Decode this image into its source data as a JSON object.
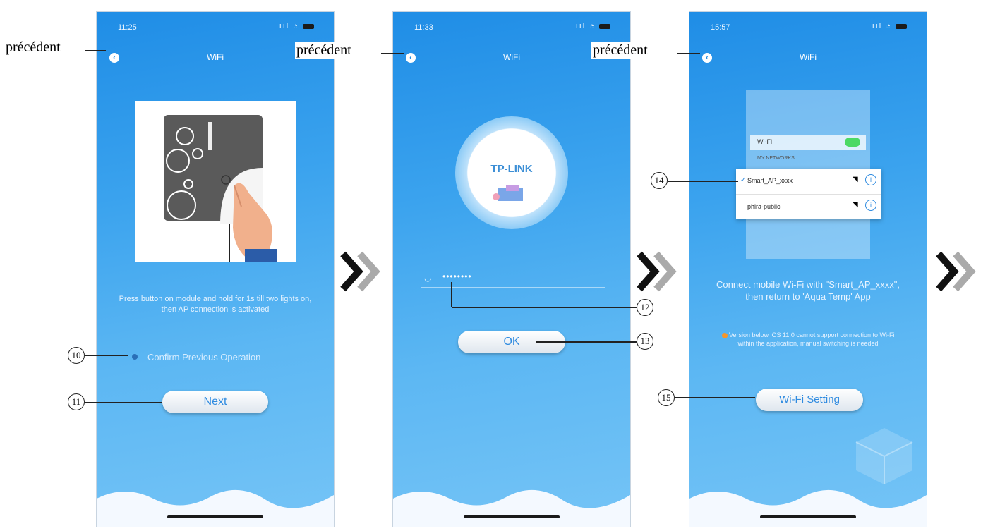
{
  "annotations": {
    "previous_label": "précédent",
    "callouts": [
      "10",
      "11",
      "12",
      "13",
      "14",
      "15"
    ]
  },
  "screens": [
    {
      "time": "11:25",
      "title": "WiFi",
      "description": "Press button on module and hold for 1s till two lights on, then AP connection is activated",
      "confirm_label": "Confirm Previous Operation",
      "next_label": "Next"
    },
    {
      "time": "11:33",
      "title": "WiFi",
      "network_name": "TP-LINK",
      "password_dots": "••••••••",
      "ok_label": "OK"
    },
    {
      "time": "15:57",
      "title": "WiFi",
      "settings_wifi_label": "Wi-Fi",
      "settings_networks_header": "MY NETWORKS",
      "network_1": "Smart_AP_xxxx",
      "network_2": "phira-public",
      "instruction": "Connect mobile Wi-Fi with \"Smart_AP_xxxx\", then return to 'Aqua Temp' App",
      "note": "Version below iOS 11.0 cannot support connection to Wi-Fi within the application, manual switching is needed",
      "wifi_setting_label": "Wi-Fi Setting"
    }
  ],
  "colors": {
    "accent": "#2f8be0",
    "background_top": "#1f8de6",
    "background_bottom": "#75c4f6"
  }
}
